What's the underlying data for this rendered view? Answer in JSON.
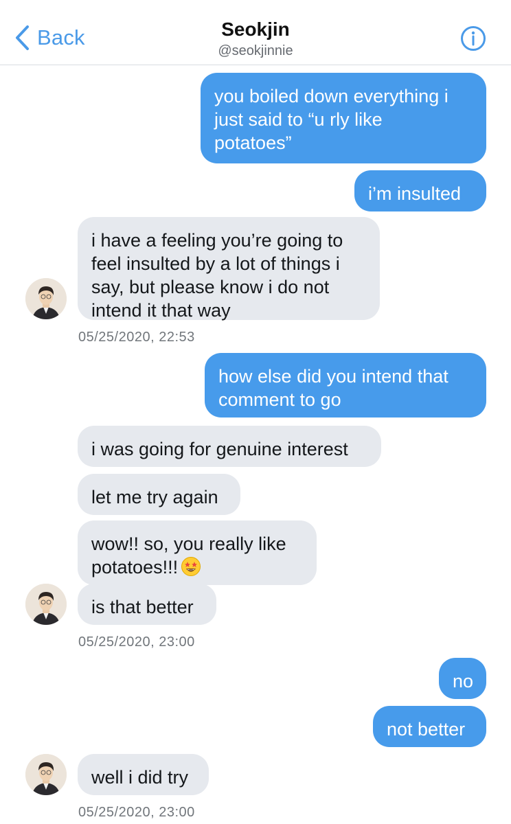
{
  "header": {
    "back_label": "Back",
    "contact_name": "Seokjin",
    "contact_handle": "@seokjinnie"
  },
  "messages": [
    {
      "dir": "out",
      "lines": [
        "you boiled down everything i",
        "just said to “u rly like",
        "potatoes”"
      ]
    },
    {
      "dir": "out",
      "lines": [
        "i’m insulted"
      ]
    },
    {
      "dir": "in",
      "lines": [
        "i have a feeling you’re going to",
        "feel insulted by a lot of things i",
        "say, but please know i do not",
        "intend it that way"
      ],
      "timestamp": "05/25/2020, 22:53"
    },
    {
      "dir": "out",
      "lines": [
        "how else did you intend that",
        "comment to go"
      ]
    },
    {
      "dir": "in",
      "lines": [
        "i was going for genuine interest"
      ]
    },
    {
      "dir": "in",
      "lines": [
        "let me try again"
      ]
    },
    {
      "dir": "in",
      "lines": [
        "wow!! so, you really like",
        "potatoes!!!"
      ],
      "emoji": "star-struck-emoji"
    },
    {
      "dir": "in",
      "lines": [
        "is that better"
      ],
      "timestamp": "05/25/2020, 23:00"
    },
    {
      "dir": "out",
      "lines": [
        "no"
      ]
    },
    {
      "dir": "out",
      "lines": [
        "not better"
      ]
    },
    {
      "dir": "in",
      "lines": [
        "well i did try"
      ],
      "timestamp": "05/25/2020, 23:00"
    }
  ],
  "colors": {
    "accent": "#4a9ae8",
    "outgoing_bubble": "#479beb",
    "incoming_bubble": "#e6e9ee"
  },
  "icons": {
    "back": "chevron-left-icon",
    "info": "info-icon",
    "avatar": "avatar"
  }
}
